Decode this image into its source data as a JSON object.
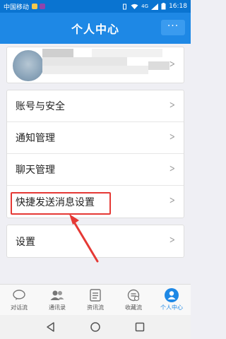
{
  "status_bar": {
    "carrier": "中国移动",
    "network": "4G",
    "time": "16:18"
  },
  "header": {
    "title": "个人中心",
    "more_label": "···"
  },
  "menu": {
    "group1": [
      "账号与安全",
      "通知管理",
      "聊天管理",
      "快捷发送消息设置"
    ],
    "group2": [
      "设置"
    ]
  },
  "tabs": [
    {
      "label": "对话流",
      "icon": "chat-icon"
    },
    {
      "label": "通讯录",
      "icon": "contacts-icon"
    },
    {
      "label": "资讯流",
      "icon": "news-icon"
    },
    {
      "label": "收藏流",
      "icon": "favorites-icon"
    },
    {
      "label": "个人中心",
      "icon": "person-icon",
      "active": true
    }
  ],
  "colors": {
    "brand_blue": "#1e88e5",
    "annotation_red": "#e53935"
  }
}
